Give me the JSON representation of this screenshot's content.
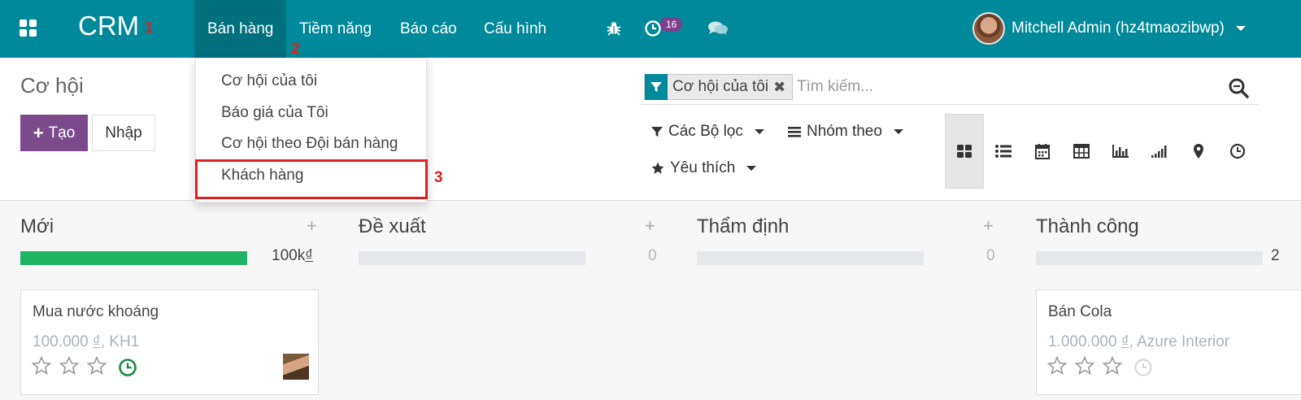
{
  "topbar": {
    "brand": "CRM",
    "brand_marker": "1",
    "menus": [
      "Bán hàng",
      "Tiềm năng",
      "Báo cáo",
      "Cấu hình"
    ],
    "menu_marker": "2",
    "activity_count": "16",
    "user_name": "Mitchell Admin (hz4tmaozibwp)",
    "accent": "#00899a",
    "active_menu_bg": "#006f7e"
  },
  "dropdown": {
    "items": [
      "Cơ hội của tôi",
      "Báo giá của Tôi",
      "Cơ hội theo Đội bán hàng",
      "Khách hàng"
    ],
    "highlight_marker": "3",
    "highlight_color": "#e02020"
  },
  "control": {
    "page_title": "Cơ hội",
    "create_label": "Tạo",
    "import_label": "Nhập",
    "create_color": "#7c4a8c"
  },
  "search": {
    "facet_value": "Cơ hội của tôi",
    "placeholder": "Tìm kiếm...",
    "filters_label": "Các Bộ lọc",
    "group_label": "Nhóm theo",
    "favorites_label": "Yêu thích"
  },
  "views": [
    "kanban-icon",
    "list-icon",
    "calendar-icon",
    "pivot-icon",
    "graph-icon",
    "cohort-icon",
    "map-icon",
    "activity-icon"
  ],
  "columns": [
    {
      "title": "Mới",
      "total": "100k",
      "currency": "₫",
      "progress": 1.0
    },
    {
      "title": "Đề xuất",
      "total": "0",
      "progress": 0
    },
    {
      "title": "Thẩm định",
      "total": "0",
      "progress": 0
    },
    {
      "title": "Thành công",
      "total": "2",
      "progress": 0
    }
  ],
  "cards": [
    {
      "title": "Mua nước khoáng",
      "amount": "100.000",
      "currency": "₫",
      "customer": ", KH1"
    },
    {
      "title": "Bán Cola",
      "amount": "1.000.000",
      "currency": "₫",
      "customer": ", Azure Interior"
    }
  ]
}
